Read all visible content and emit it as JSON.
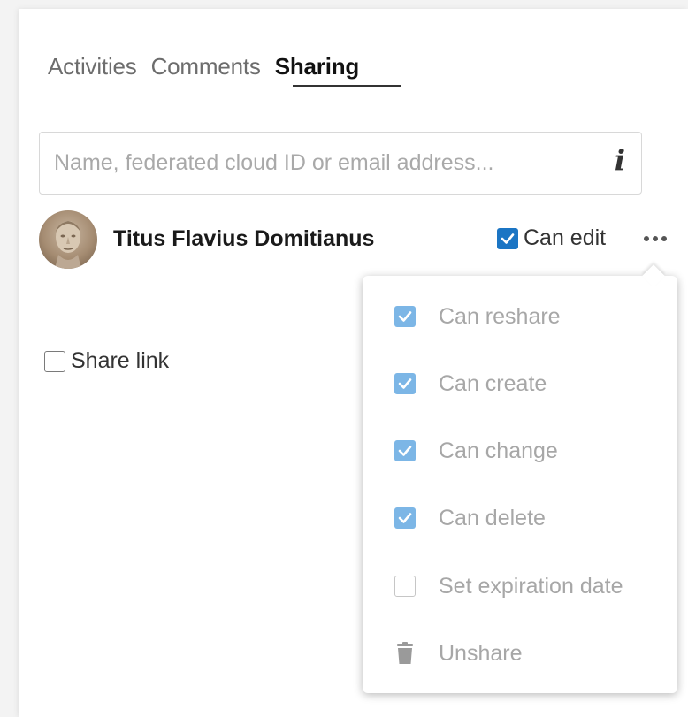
{
  "tabs": [
    {
      "label": "Activities"
    },
    {
      "label": "Comments"
    },
    {
      "label": "Sharing"
    }
  ],
  "share_input": {
    "placeholder": "Name, federated cloud ID or email address...",
    "info_icon": "i"
  },
  "sharee": {
    "name": "Titus Flavius Domitianus",
    "can_edit_label": "Can edit",
    "can_edit_checked": true
  },
  "share_link": {
    "label": "Share link",
    "checked": false
  },
  "menu": {
    "items": [
      {
        "label": "Can reshare",
        "checked": true
      },
      {
        "label": "Can create",
        "checked": true
      },
      {
        "label": "Can change",
        "checked": true
      },
      {
        "label": "Can delete",
        "checked": true
      },
      {
        "label": "Set expiration date",
        "checked": false
      },
      {
        "label": "Unshare",
        "icon": "trash-icon"
      }
    ]
  },
  "colors": {
    "accent": "#1b75c4",
    "accent_light": "#7cb6e6",
    "muted_text": "#a7a7a7"
  }
}
